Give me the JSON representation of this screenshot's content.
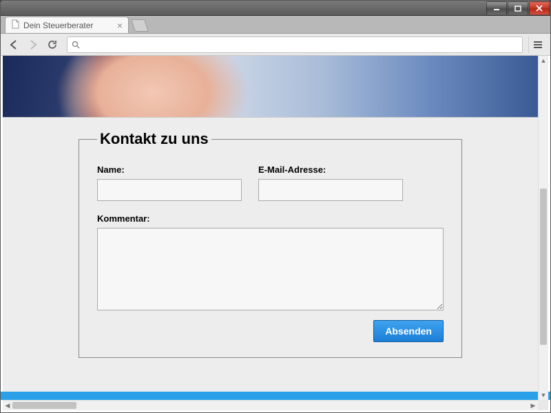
{
  "window": {
    "tab_title": "Dein Steuerberater"
  },
  "form": {
    "legend": "Kontakt zu uns",
    "name_label": "Name:",
    "name_value": "",
    "email_label": "E-Mail-Adresse:",
    "email_value": "",
    "comment_label": "Kommentar:",
    "comment_value": "",
    "submit_label": "Absenden"
  }
}
